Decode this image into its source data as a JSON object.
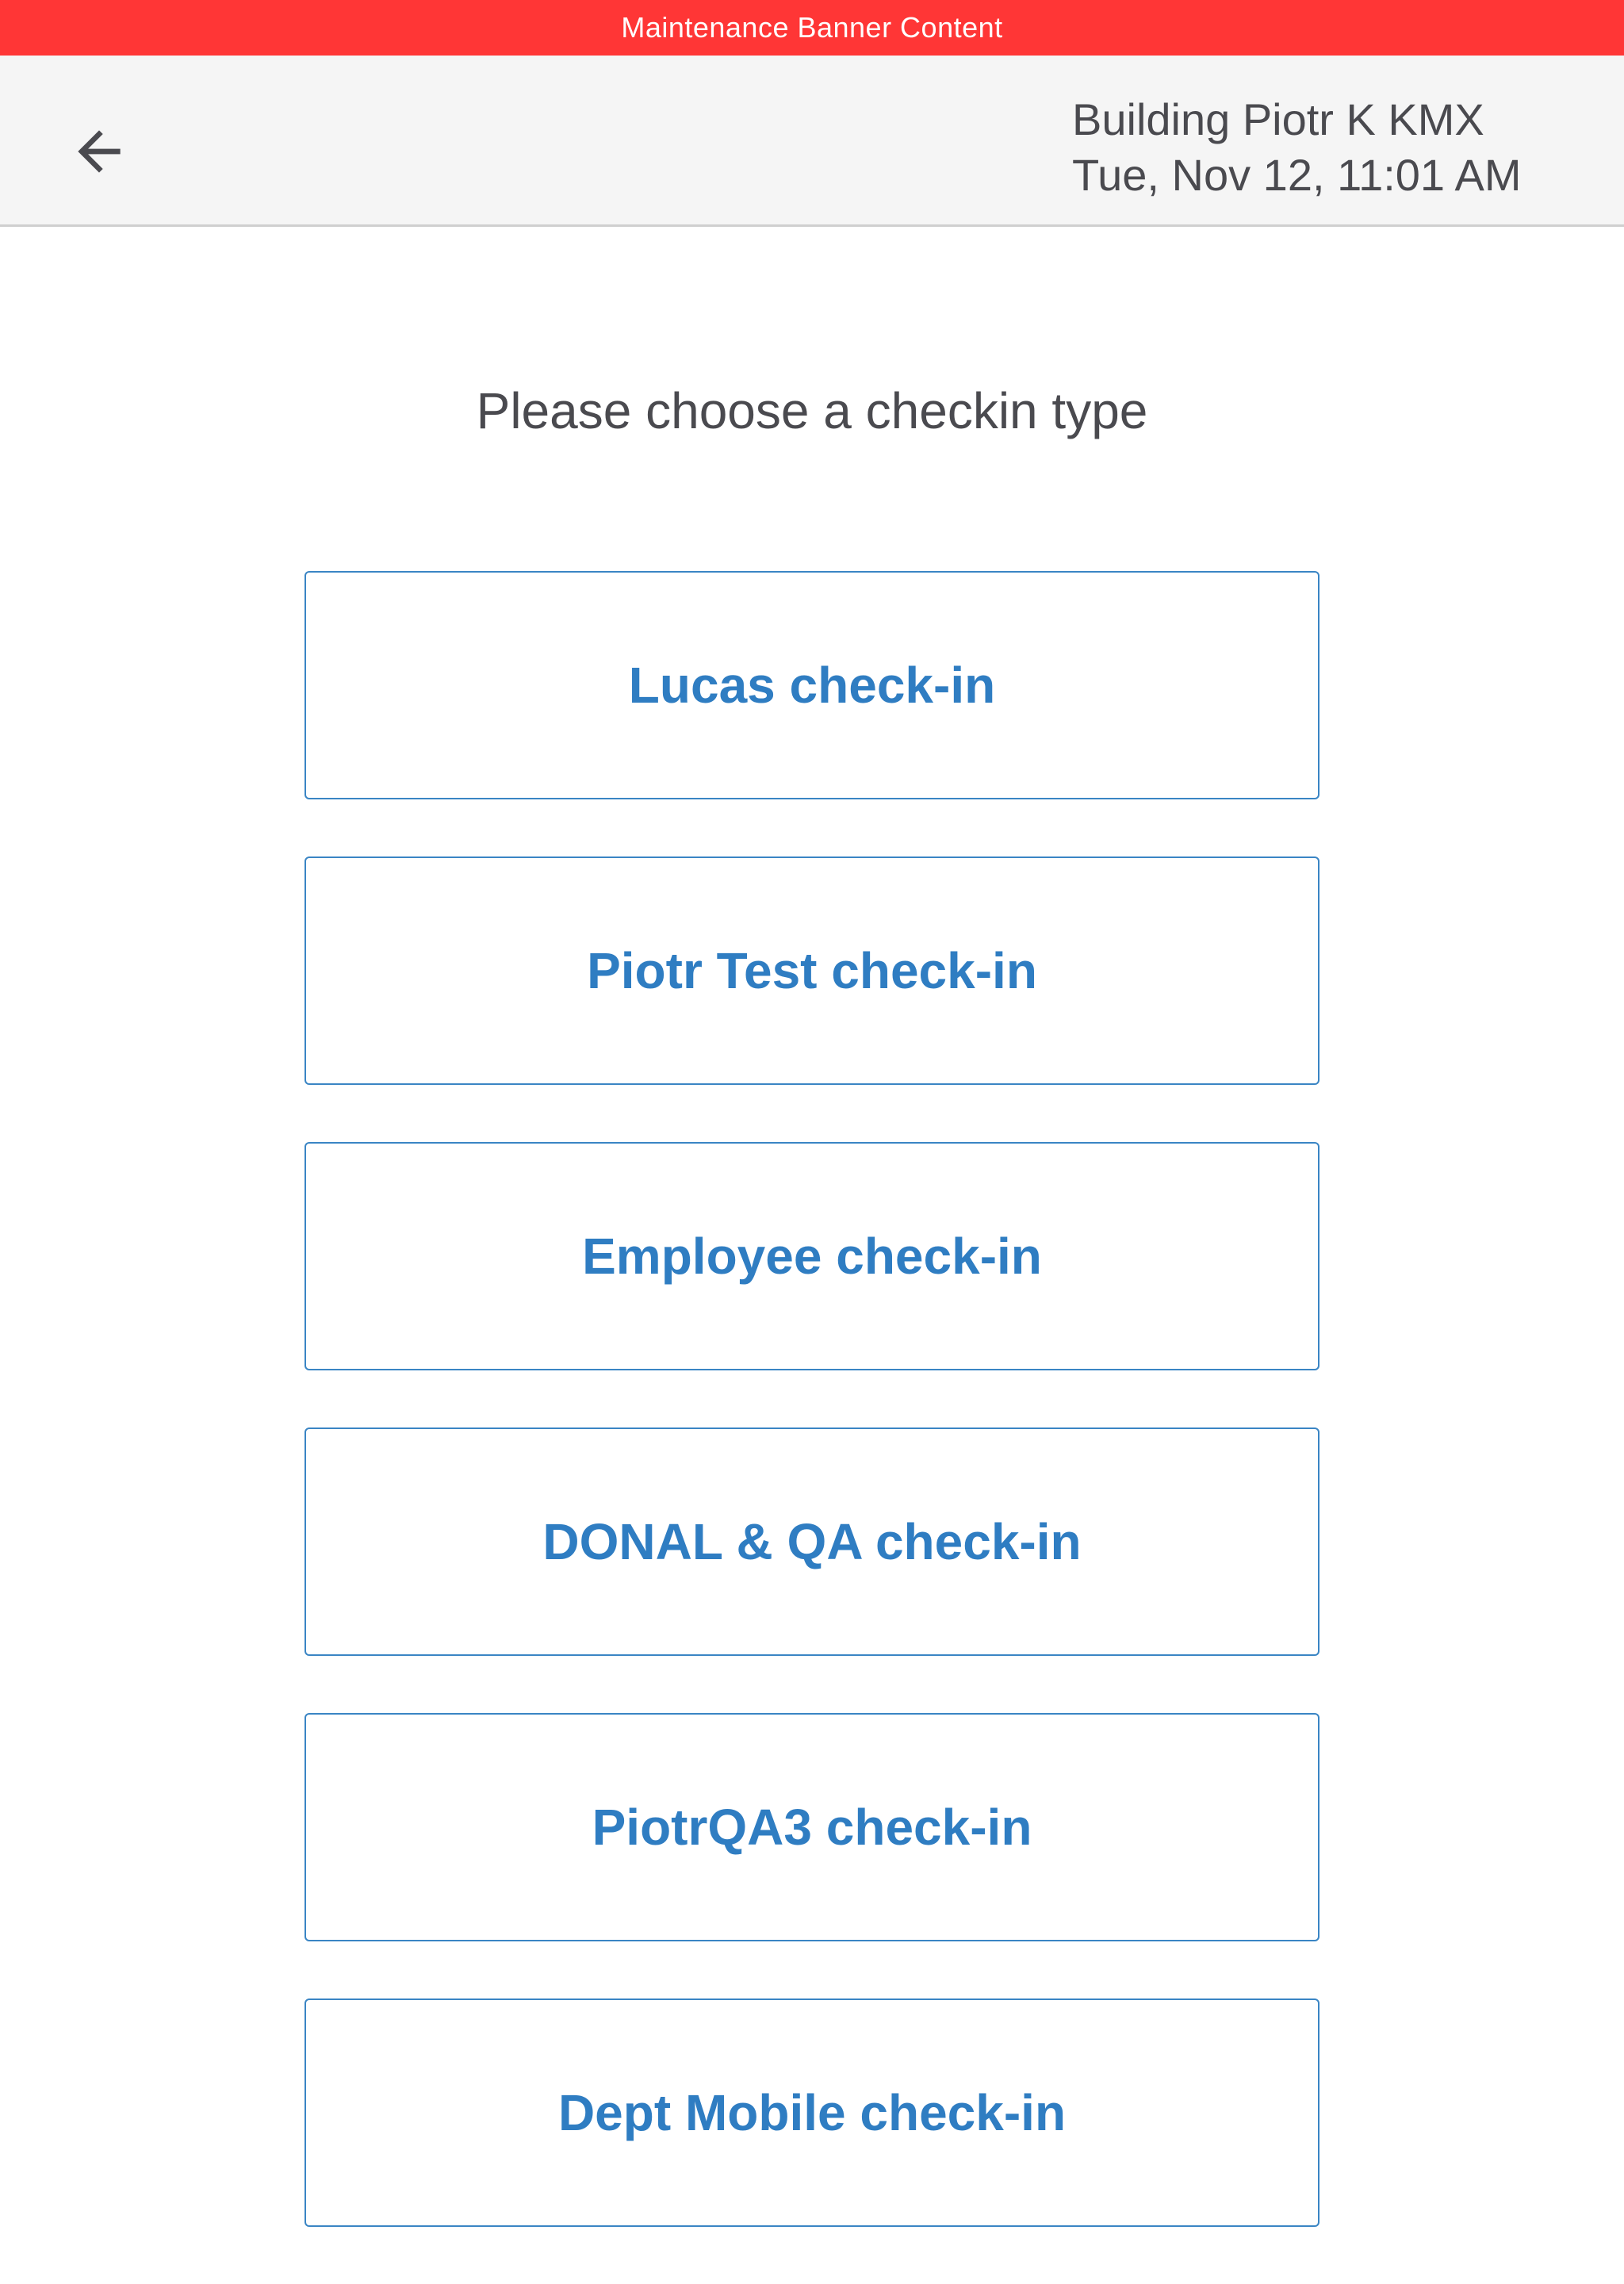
{
  "banner": {
    "text": "Maintenance Banner Content",
    "color": "#ff3636"
  },
  "header": {
    "back_icon": "arrow-left-icon",
    "building": "Building Piotr K KMX",
    "datetime": "Tue, Nov 12, 11:01 AM"
  },
  "main": {
    "prompt": "Please choose a checkin type",
    "options": [
      {
        "label": "Lucas check-in"
      },
      {
        "label": "Piotr Test check-in"
      },
      {
        "label": "Employee check-in"
      },
      {
        "label": "DONAL & QA check-in"
      },
      {
        "label": "PiotrQA3 check-in"
      },
      {
        "label": "Dept Mobile check-in"
      }
    ],
    "accent_color": "#2f7dc2"
  }
}
